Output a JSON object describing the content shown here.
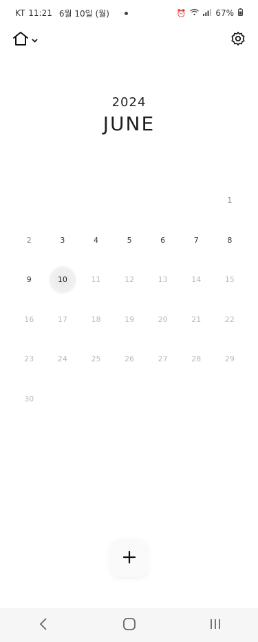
{
  "status_bar": {
    "carrier": "KT",
    "time": "11:21",
    "date": "6월 10일 (월)",
    "battery": "67%"
  },
  "calendar": {
    "year": "2024",
    "month": "JUNE",
    "today": 10,
    "weeks": [
      [
        "",
        "",
        "",
        "",
        "",
        "",
        "1"
      ],
      [
        "2",
        "3",
        "4",
        "5",
        "6",
        "7",
        "8"
      ],
      [
        "9",
        "10",
        "11",
        "12",
        "13",
        "14",
        "15"
      ],
      [
        "16",
        "17",
        "18",
        "19",
        "20",
        "21",
        "22"
      ],
      [
        "23",
        "24",
        "25",
        "26",
        "27",
        "28",
        "29"
      ],
      [
        "30",
        "",
        "",
        "",
        "",
        "",
        ""
      ]
    ]
  },
  "icons": {
    "home": "home-icon",
    "chevron": "chevron-down-icon",
    "settings": "gear-icon",
    "add": "plus-icon",
    "back": "back-icon",
    "home_nav": "home-nav-icon",
    "recents": "recents-icon"
  }
}
